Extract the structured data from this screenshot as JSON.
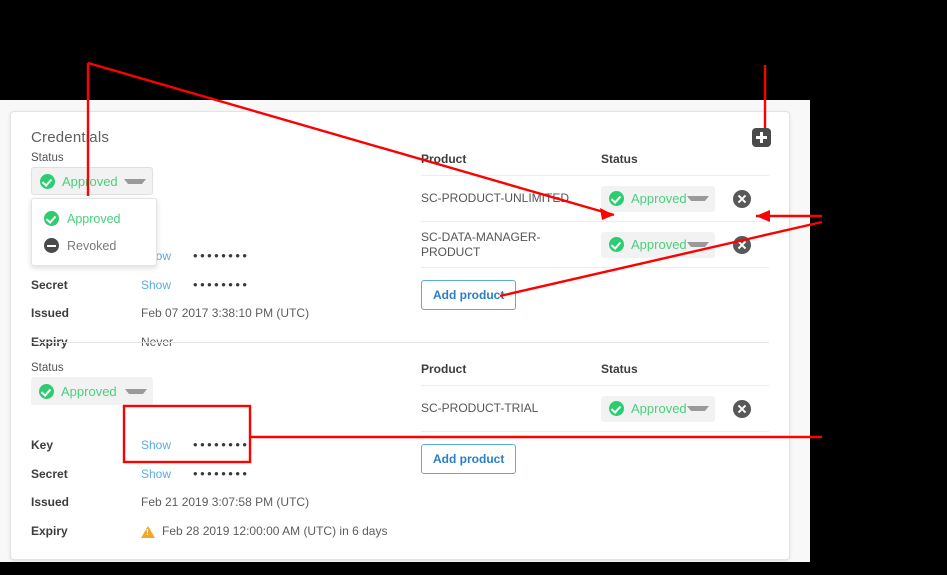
{
  "card": {
    "title": "Credentials",
    "add_icon": "plus-icon"
  },
  "labels": {
    "status": "Status",
    "key": "Key",
    "secret": "Secret",
    "issued": "Issued",
    "expiry": "Expiry",
    "product": "Product",
    "product_status": "Status",
    "show": "Show",
    "masked_value": "••••••••",
    "add_product": "Add product"
  },
  "status_options": [
    {
      "label": "Approved",
      "icon": "check-circle-icon",
      "state": "approved"
    },
    {
      "label": "Revoked",
      "icon": "minus-circle-icon",
      "state": "revoked"
    }
  ],
  "credentials": [
    {
      "status": "Approved",
      "key_masked": "••••••••",
      "secret_masked": "••••••••",
      "issued": "Feb 07 2017 3:38:10 PM (UTC)",
      "expiry": "Never",
      "expiry_warning": false,
      "dropdown_open": true,
      "products": [
        {
          "name": "SC-PRODUCT-UNLIMITED",
          "status": "Approved"
        },
        {
          "name": "SC-DATA-MANAGER-PRODUCT",
          "status": "Approved"
        }
      ]
    },
    {
      "status": "Approved",
      "key_masked": "••••••••",
      "secret_masked": "••••••••",
      "issued": "Feb 21 2019 3:07:58 PM (UTC)",
      "expiry": "Feb 28 2019 12:00:00 AM (UTC) in 6 days",
      "expiry_warning": true,
      "dropdown_open": false,
      "products": [
        {
          "name": "SC-PRODUCT-TRIAL",
          "status": "Approved"
        }
      ]
    }
  ],
  "colors": {
    "approved_green": "#4ad07d",
    "check_green": "#2ecc71",
    "link_blue": "#5aace0",
    "annotation_red": "#ff0000",
    "warning_orange": "#f5a623",
    "delete_gray": "#585858",
    "pill_bg": "#f2f2f2"
  }
}
